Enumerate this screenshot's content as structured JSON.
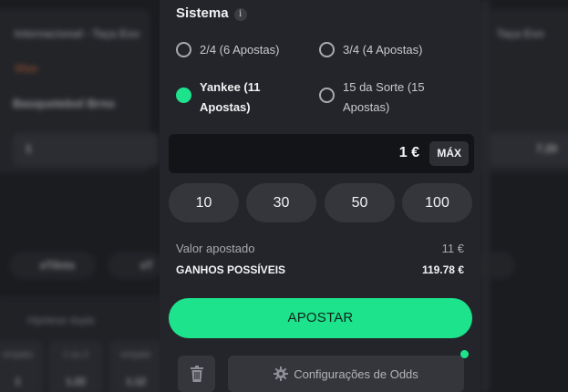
{
  "background": {
    "match_title": "Internacional - Taça Eso",
    "match_title_right": "Taça Esn",
    "live_label": "Vivo",
    "sport_name": "Basquetebol Brno",
    "odd_left": "1",
    "odd_right": "7.20",
    "chip_1": "eTênis",
    "chip_2": "eT",
    "section_title": "Hipótese dupla",
    "cells": [
      {
        "label": "empate",
        "value": "1"
      },
      {
        "label": "1 ou 2",
        "value": "1.22"
      },
      {
        "label": "empate",
        "value": "1.12"
      }
    ]
  },
  "slip": {
    "title": "Sistema",
    "info_icon": "info-icon",
    "options": [
      {
        "label": "2/4 (6 Apostas)",
        "selected": false
      },
      {
        "label": "3/4 (4 Apostas)",
        "selected": false
      },
      {
        "label": "Yankee (11 Apostas)",
        "selected": true
      },
      {
        "label": "15 da Sorte (15 Apostas)",
        "selected": false
      }
    ],
    "stake": {
      "value": "1 €",
      "max_label": "MÁX"
    },
    "quick_amounts": [
      "10",
      "30",
      "50",
      "100"
    ],
    "staked_label": "Valor apostado",
    "staked_value": "11 €",
    "winnings_label": "GANHOS POSSÍVEIS",
    "winnings_value": "119.78 €",
    "bet_button": "APOSTAR",
    "trash_icon": "trash-icon",
    "odds_settings_label": "Configurações de Odds",
    "gear_icon": "gear-icon",
    "accent_color": "#1de38d"
  }
}
